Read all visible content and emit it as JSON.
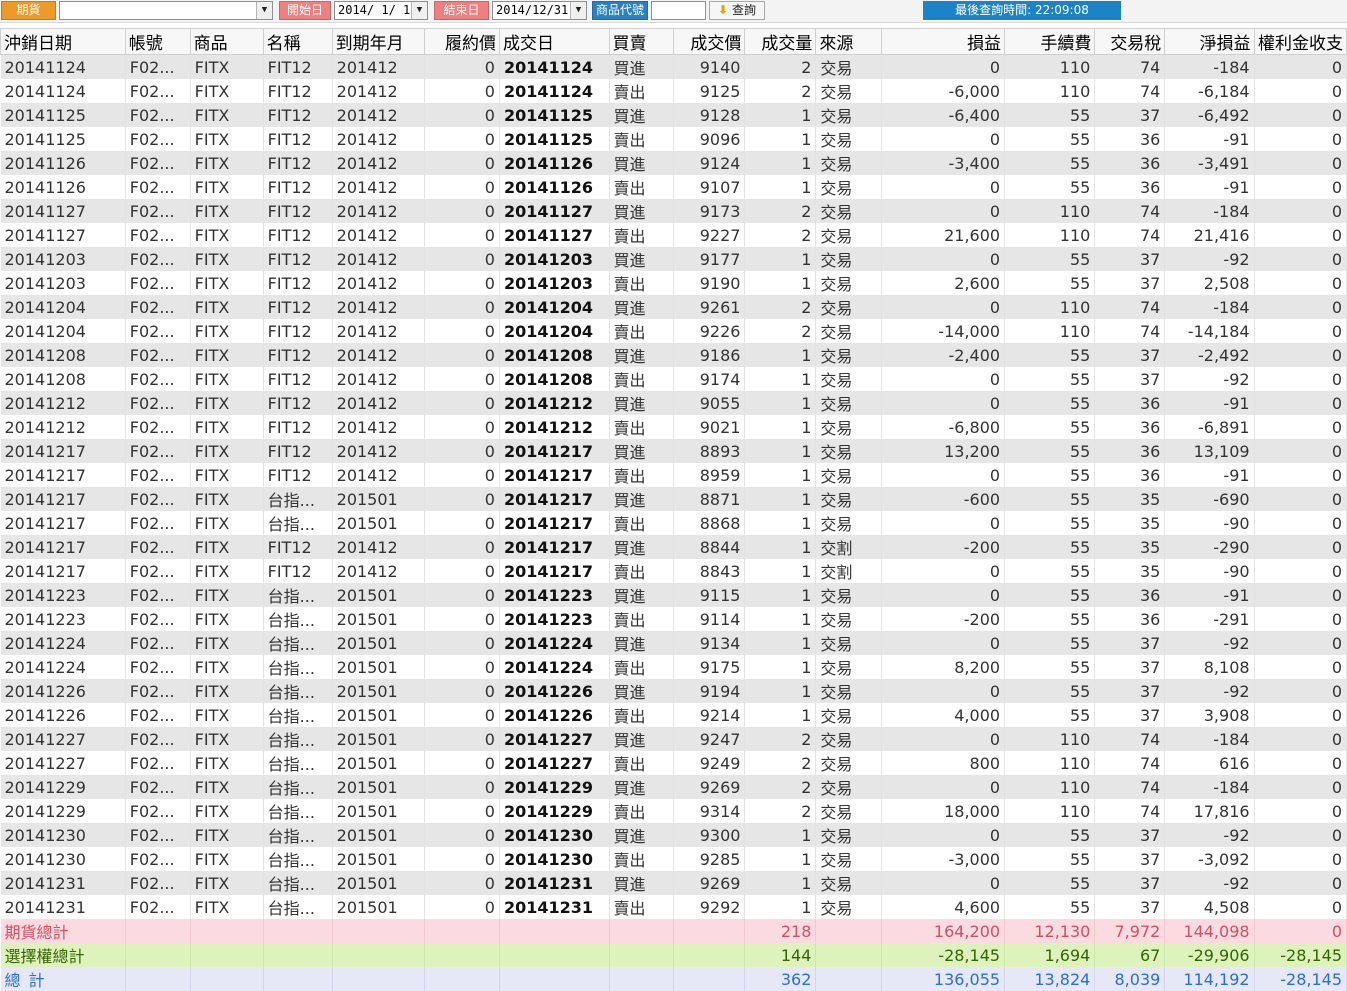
{
  "toolbar": {
    "category": "期貨",
    "account_value": "",
    "start_label": "開始日",
    "start_date": "2014/ 1/ 1",
    "end_label": "結束日",
    "end_date": "2014/12/31",
    "product_label": "商品代號",
    "product_value": "",
    "query_label": "查詢",
    "status": "最後查詢時間: 22:09:08"
  },
  "columns": [
    "沖銷日期",
    "帳號",
    "商品",
    "名稱",
    "到期年月",
    "履約價",
    "成交日",
    "買賣",
    "成交價",
    "成交量",
    "來源",
    "損益",
    "手續費",
    "交易稅",
    "淨損益",
    "權利金收支"
  ],
  "rows": [
    [
      "20141124",
      "F02...",
      "FITX",
      "FIT12",
      "201412",
      "0",
      "20141124",
      "買進",
      "9140",
      "2",
      "交易",
      "0",
      "110",
      "74",
      "-184",
      "0"
    ],
    [
      "20141124",
      "F02...",
      "FITX",
      "FIT12",
      "201412",
      "0",
      "20141124",
      "賣出",
      "9125",
      "2",
      "交易",
      "-6,000",
      "110",
      "74",
      "-6,184",
      "0"
    ],
    [
      "20141125",
      "F02...",
      "FITX",
      "FIT12",
      "201412",
      "0",
      "20141125",
      "買進",
      "9128",
      "1",
      "交易",
      "-6,400",
      "55",
      "37",
      "-6,492",
      "0"
    ],
    [
      "20141125",
      "F02...",
      "FITX",
      "FIT12",
      "201412",
      "0",
      "20141125",
      "賣出",
      "9096",
      "1",
      "交易",
      "0",
      "55",
      "36",
      "-91",
      "0"
    ],
    [
      "20141126",
      "F02...",
      "FITX",
      "FIT12",
      "201412",
      "0",
      "20141126",
      "買進",
      "9124",
      "1",
      "交易",
      "-3,400",
      "55",
      "36",
      "-3,491",
      "0"
    ],
    [
      "20141126",
      "F02...",
      "FITX",
      "FIT12",
      "201412",
      "0",
      "20141126",
      "賣出",
      "9107",
      "1",
      "交易",
      "0",
      "55",
      "36",
      "-91",
      "0"
    ],
    [
      "20141127",
      "F02...",
      "FITX",
      "FIT12",
      "201412",
      "0",
      "20141127",
      "買進",
      "9173",
      "2",
      "交易",
      "0",
      "110",
      "74",
      "-184",
      "0"
    ],
    [
      "20141127",
      "F02...",
      "FITX",
      "FIT12",
      "201412",
      "0",
      "20141127",
      "賣出",
      "9227",
      "2",
      "交易",
      "21,600",
      "110",
      "74",
      "21,416",
      "0"
    ],
    [
      "20141203",
      "F02...",
      "FITX",
      "FIT12",
      "201412",
      "0",
      "20141203",
      "買進",
      "9177",
      "1",
      "交易",
      "0",
      "55",
      "37",
      "-92",
      "0"
    ],
    [
      "20141203",
      "F02...",
      "FITX",
      "FIT12",
      "201412",
      "0",
      "20141203",
      "賣出",
      "9190",
      "1",
      "交易",
      "2,600",
      "55",
      "37",
      "2,508",
      "0"
    ],
    [
      "20141204",
      "F02...",
      "FITX",
      "FIT12",
      "201412",
      "0",
      "20141204",
      "買進",
      "9261",
      "2",
      "交易",
      "0",
      "110",
      "74",
      "-184",
      "0"
    ],
    [
      "20141204",
      "F02...",
      "FITX",
      "FIT12",
      "201412",
      "0",
      "20141204",
      "賣出",
      "9226",
      "2",
      "交易",
      "-14,000",
      "110",
      "74",
      "-14,184",
      "0"
    ],
    [
      "20141208",
      "F02...",
      "FITX",
      "FIT12",
      "201412",
      "0",
      "20141208",
      "買進",
      "9186",
      "1",
      "交易",
      "-2,400",
      "55",
      "37",
      "-2,492",
      "0"
    ],
    [
      "20141208",
      "F02...",
      "FITX",
      "FIT12",
      "201412",
      "0",
      "20141208",
      "賣出",
      "9174",
      "1",
      "交易",
      "0",
      "55",
      "37",
      "-92",
      "0"
    ],
    [
      "20141212",
      "F02...",
      "FITX",
      "FIT12",
      "201412",
      "0",
      "20141212",
      "買進",
      "9055",
      "1",
      "交易",
      "0",
      "55",
      "36",
      "-91",
      "0"
    ],
    [
      "20141212",
      "F02...",
      "FITX",
      "FIT12",
      "201412",
      "0",
      "20141212",
      "賣出",
      "9021",
      "1",
      "交易",
      "-6,800",
      "55",
      "36",
      "-6,891",
      "0"
    ],
    [
      "20141217",
      "F02...",
      "FITX",
      "FIT12",
      "201412",
      "0",
      "20141217",
      "買進",
      "8893",
      "1",
      "交易",
      "13,200",
      "55",
      "36",
      "13,109",
      "0"
    ],
    [
      "20141217",
      "F02...",
      "FITX",
      "FIT12",
      "201412",
      "0",
      "20141217",
      "賣出",
      "8959",
      "1",
      "交易",
      "0",
      "55",
      "36",
      "-91",
      "0"
    ],
    [
      "20141217",
      "F02...",
      "FITX",
      "台指...",
      "201501",
      "0",
      "20141217",
      "買進",
      "8871",
      "1",
      "交易",
      "-600",
      "55",
      "35",
      "-690",
      "0"
    ],
    [
      "20141217",
      "F02...",
      "FITX",
      "台指...",
      "201501",
      "0",
      "20141217",
      "賣出",
      "8868",
      "1",
      "交易",
      "0",
      "55",
      "35",
      "-90",
      "0"
    ],
    [
      "20141217",
      "F02...",
      "FITX",
      "FIT12",
      "201412",
      "0",
      "20141217",
      "買進",
      "8844",
      "1",
      "交割",
      "-200",
      "55",
      "35",
      "-290",
      "0"
    ],
    [
      "20141217",
      "F02...",
      "FITX",
      "FIT12",
      "201412",
      "0",
      "20141217",
      "賣出",
      "8843",
      "1",
      "交割",
      "0",
      "55",
      "35",
      "-90",
      "0"
    ],
    [
      "20141223",
      "F02...",
      "FITX",
      "台指...",
      "201501",
      "0",
      "20141223",
      "買進",
      "9115",
      "1",
      "交易",
      "0",
      "55",
      "36",
      "-91",
      "0"
    ],
    [
      "20141223",
      "F02...",
      "FITX",
      "台指...",
      "201501",
      "0",
      "20141223",
      "賣出",
      "9114",
      "1",
      "交易",
      "-200",
      "55",
      "36",
      "-291",
      "0"
    ],
    [
      "20141224",
      "F02...",
      "FITX",
      "台指...",
      "201501",
      "0",
      "20141224",
      "買進",
      "9134",
      "1",
      "交易",
      "0",
      "55",
      "37",
      "-92",
      "0"
    ],
    [
      "20141224",
      "F02...",
      "FITX",
      "台指...",
      "201501",
      "0",
      "20141224",
      "賣出",
      "9175",
      "1",
      "交易",
      "8,200",
      "55",
      "37",
      "8,108",
      "0"
    ],
    [
      "20141226",
      "F02...",
      "FITX",
      "台指...",
      "201501",
      "0",
      "20141226",
      "買進",
      "9194",
      "1",
      "交易",
      "0",
      "55",
      "37",
      "-92",
      "0"
    ],
    [
      "20141226",
      "F02...",
      "FITX",
      "台指...",
      "201501",
      "0",
      "20141226",
      "賣出",
      "9214",
      "1",
      "交易",
      "4,000",
      "55",
      "37",
      "3,908",
      "0"
    ],
    [
      "20141227",
      "F02...",
      "FITX",
      "台指...",
      "201501",
      "0",
      "20141227",
      "買進",
      "9247",
      "2",
      "交易",
      "0",
      "110",
      "74",
      "-184",
      "0"
    ],
    [
      "20141227",
      "F02...",
      "FITX",
      "台指...",
      "201501",
      "0",
      "20141227",
      "賣出",
      "9249",
      "2",
      "交易",
      "800",
      "110",
      "74",
      "616",
      "0"
    ],
    [
      "20141229",
      "F02...",
      "FITX",
      "台指...",
      "201501",
      "0",
      "20141229",
      "買進",
      "9269",
      "2",
      "交易",
      "0",
      "110",
      "74",
      "-184",
      "0"
    ],
    [
      "20141229",
      "F02...",
      "FITX",
      "台指...",
      "201501",
      "0",
      "20141229",
      "賣出",
      "9314",
      "2",
      "交易",
      "18,000",
      "110",
      "74",
      "17,816",
      "0"
    ],
    [
      "20141230",
      "F02...",
      "FITX",
      "台指...",
      "201501",
      "0",
      "20141230",
      "買進",
      "9300",
      "1",
      "交易",
      "0",
      "55",
      "37",
      "-92",
      "0"
    ],
    [
      "20141230",
      "F02...",
      "FITX",
      "台指...",
      "201501",
      "0",
      "20141230",
      "賣出",
      "9285",
      "1",
      "交易",
      "-3,000",
      "55",
      "37",
      "-3,092",
      "0"
    ],
    [
      "20141231",
      "F02...",
      "FITX",
      "台指...",
      "201501",
      "0",
      "20141231",
      "買進",
      "9269",
      "1",
      "交易",
      "0",
      "55",
      "37",
      "-92",
      "0"
    ],
    [
      "20141231",
      "F02...",
      "FITX",
      "台指...",
      "201501",
      "0",
      "20141231",
      "賣出",
      "9292",
      "1",
      "交易",
      "4,600",
      "55",
      "37",
      "4,508",
      "0"
    ]
  ],
  "summary": [
    {
      "label": "期貨總計",
      "volume": "218",
      "pnl": "164,200",
      "fee": "12,130",
      "tax": "7,972",
      "net": "144,098",
      "premium": "0"
    },
    {
      "label": "選擇權總計",
      "volume": "144",
      "pnl": "-28,145",
      "fee": "1,694",
      "tax": "67",
      "net": "-29,906",
      "premium": "-28,145"
    },
    {
      "label": "總計",
      "volume": "362",
      "pnl": "136,055",
      "fee": "13,824",
      "tax": "8,039",
      "net": "114,192",
      "premium": "-28,145"
    }
  ],
  "colors": {
    "even_row": "#e6e6e6",
    "futures_total_bg": "#fbdbe1",
    "options_total_bg": "#ddf3bb",
    "grand_total_bg": "#e6e8f7",
    "status_bg": "#1c83c7"
  },
  "icons": {
    "query": "arrow-down-icon",
    "dropdown": "chevron-down-icon"
  }
}
